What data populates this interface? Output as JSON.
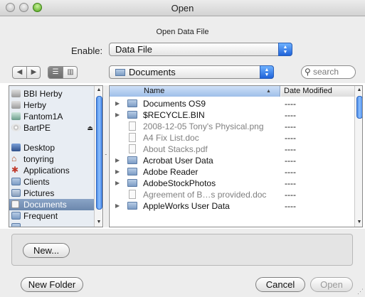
{
  "window": {
    "title": "Open"
  },
  "accessory": {
    "heading": "Open Data File",
    "enable_label": "Enable:",
    "enable_value": "Data File"
  },
  "toolbar": {
    "location": "Documents",
    "search_placeholder": "search"
  },
  "sidebar": {
    "items": [
      {
        "label": "BBI Herby",
        "icon": "drive-icon"
      },
      {
        "label": "Herby",
        "icon": "drive-icon"
      },
      {
        "label": "Fantom1A",
        "icon": "drive-icon"
      },
      {
        "label": "BartPE",
        "icon": "cd-icon",
        "eject": "⏏"
      },
      {
        "label": "Desktop",
        "icon": "desktop-icon"
      },
      {
        "label": "tonyring",
        "icon": "home-icon"
      },
      {
        "label": "Applications",
        "icon": "applications-icon"
      },
      {
        "label": "Clients",
        "icon": "folder-icon"
      },
      {
        "label": "Pictures",
        "icon": "pictures-icon"
      },
      {
        "label": "Documents",
        "icon": "documents-icon",
        "selected": true
      },
      {
        "label": "Frequent",
        "icon": "folder-icon"
      }
    ]
  },
  "file_list": {
    "columns": {
      "name": "Name",
      "date": "Date Modified"
    },
    "rows": [
      {
        "name": "Documents OS9",
        "date": "----",
        "kind": "folder",
        "expandable": true
      },
      {
        "name": "$RECYCLE.BIN",
        "date": "----",
        "kind": "folder",
        "expandable": true
      },
      {
        "name": "2008-12-05 Tony's Physical.png",
        "date": "----",
        "kind": "file",
        "dim": true
      },
      {
        "name": "A4 Fix List.doc",
        "date": "----",
        "kind": "file",
        "dim": true
      },
      {
        "name": "About Stacks.pdf",
        "date": "----",
        "kind": "file",
        "dim": true
      },
      {
        "name": "Acrobat User Data",
        "date": "----",
        "kind": "folder",
        "expandable": true
      },
      {
        "name": "Adobe Reader",
        "date": "----",
        "kind": "folder",
        "expandable": true
      },
      {
        "name": "AdobeStockPhotos",
        "date": "----",
        "kind": "folder",
        "expandable": true
      },
      {
        "name": "Agreement of B…s provided.doc",
        "date": "----",
        "kind": "file",
        "dim": true
      },
      {
        "name": "AppleWorks User Data",
        "date": "----",
        "kind": "folder",
        "expandable": true
      }
    ]
  },
  "buttons": {
    "new": "New...",
    "new_folder": "New Folder",
    "cancel": "Cancel",
    "open": "Open"
  },
  "colors": {
    "selection": "#6b87ad",
    "accent_blue": "#1f63d9",
    "zoom_green": "#4ea21a"
  }
}
